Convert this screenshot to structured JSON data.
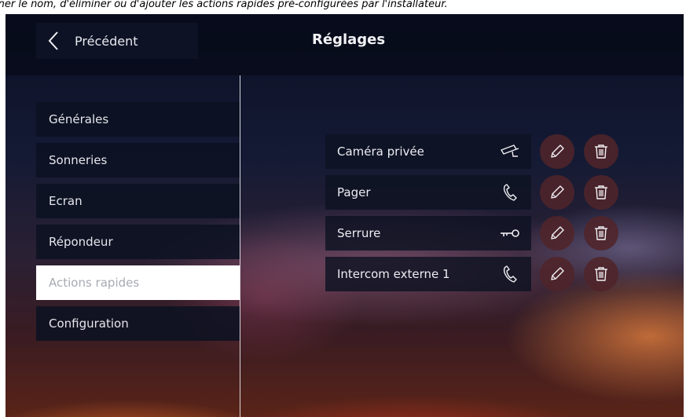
{
  "caption": "iner le nom, d'éliminer ou d'ajouter les actions rapides pré-configurées par l'installateur.",
  "header": {
    "back_label": "Précédent",
    "title": "Réglages"
  },
  "sidebar": {
    "items": [
      {
        "label": "Générales",
        "active": false
      },
      {
        "label": "Sonneries",
        "active": false
      },
      {
        "label": "Ecran",
        "active": false
      },
      {
        "label": "Répondeur",
        "active": false
      },
      {
        "label": "Actions rapides",
        "active": true
      },
      {
        "label": "Configuration",
        "active": false
      }
    ]
  },
  "actions": {
    "items": [
      {
        "label": "Caméra privée",
        "icon": "camera-icon"
      },
      {
        "label": "Pager",
        "icon": "phone-icon"
      },
      {
        "label": "Serrure",
        "icon": "key-icon"
      },
      {
        "label": "Intercom externe 1",
        "icon": "phone-icon"
      }
    ],
    "edit_icon": "pencil-icon",
    "delete_icon": "trash-icon"
  },
  "colors": {
    "active_item_bg": "#ffffff",
    "active_item_text": "#a7aab2",
    "circle_button_bg": "#50242a"
  }
}
